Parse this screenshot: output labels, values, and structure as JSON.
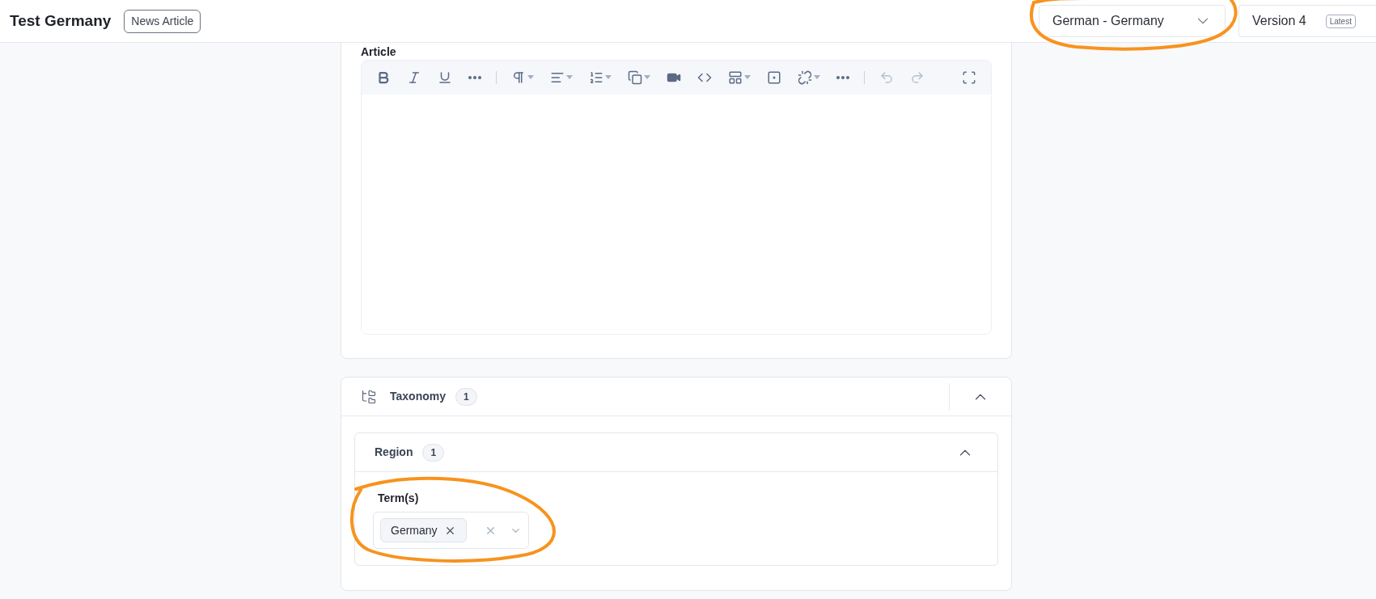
{
  "header": {
    "title": "Test Germany",
    "content_type": "News Article",
    "language": "German - Germany",
    "version": "Version 4",
    "version_badge": "Latest"
  },
  "article": {
    "label": "Article",
    "toolbar": [
      {
        "kind": "bold",
        "menu": false,
        "disabled": false
      },
      {
        "kind": "italic",
        "menu": false,
        "disabled": false
      },
      {
        "kind": "underline",
        "menu": false,
        "disabled": false
      },
      {
        "kind": "more",
        "menu": false,
        "disabled": false
      },
      {
        "kind": "separator"
      },
      {
        "kind": "paragraph",
        "menu": true,
        "disabled": false
      },
      {
        "kind": "align",
        "menu": true,
        "disabled": false
      },
      {
        "kind": "list",
        "menu": true,
        "disabled": false
      },
      {
        "kind": "copy",
        "menu": true,
        "disabled": false
      },
      {
        "kind": "video",
        "menu": false,
        "disabled": false
      },
      {
        "kind": "code",
        "menu": false,
        "disabled": false
      },
      {
        "kind": "table",
        "menu": true,
        "disabled": false
      },
      {
        "kind": "embed",
        "menu": false,
        "disabled": false
      },
      {
        "kind": "unlink",
        "menu": true,
        "disabled": false
      },
      {
        "kind": "more",
        "menu": false,
        "disabled": false
      },
      {
        "kind": "separator"
      },
      {
        "kind": "undo",
        "menu": false,
        "disabled": true
      },
      {
        "kind": "redo",
        "menu": false,
        "disabled": true
      },
      {
        "kind": "fullscreen",
        "menu": false,
        "disabled": false
      }
    ]
  },
  "taxonomy": {
    "title": "Taxonomy",
    "count": "1",
    "expanded": true,
    "region": {
      "title": "Region",
      "count": "1",
      "expanded": true,
      "field_label": "Term(s)",
      "terms": [
        "Germany"
      ]
    }
  }
}
